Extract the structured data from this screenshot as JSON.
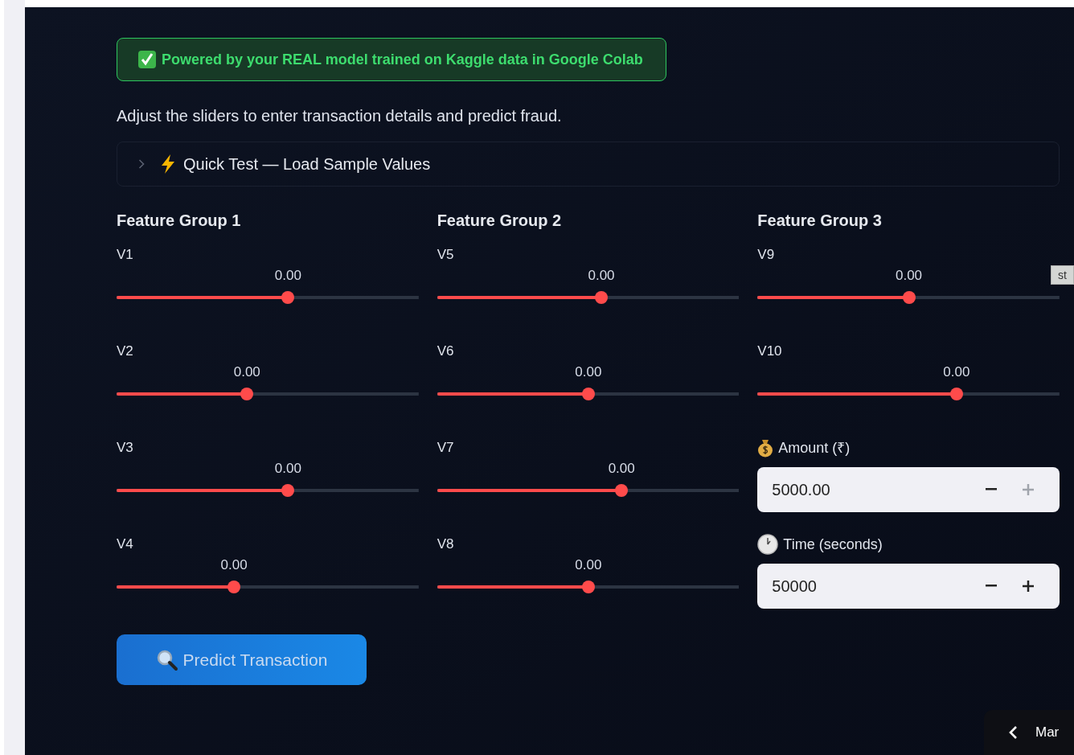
{
  "banner": {
    "text": "Powered by your REAL model trained on Kaggle data in Google Colab"
  },
  "intro": "Adjust the sliders to enter transaction details and predict fraud.",
  "expander": {
    "label": "Quick Test — Load Sample Values",
    "expanded": false
  },
  "groups": [
    {
      "title": "Feature Group 1",
      "items": [
        {
          "kind": "slider",
          "label": "V1",
          "reading": "0.00",
          "level": 0.568
        },
        {
          "kind": "slider",
          "label": "V2",
          "reading": "0.00",
          "level": 0.432
        },
        {
          "kind": "slider",
          "label": "V3",
          "reading": "0.00",
          "level": 0.568
        },
        {
          "kind": "slider",
          "label": "V4",
          "reading": "0.00",
          "level": 0.389
        }
      ]
    },
    {
      "title": "Feature Group 2",
      "items": [
        {
          "kind": "slider",
          "label": "V5",
          "reading": "0.00",
          "level": 0.544
        },
        {
          "kind": "slider",
          "label": "V6",
          "reading": "0.00",
          "level": 0.501
        },
        {
          "kind": "slider",
          "label": "V7",
          "reading": "0.00",
          "level": 0.611
        },
        {
          "kind": "slider",
          "label": "V8",
          "reading": "0.00",
          "level": 0.501
        }
      ]
    },
    {
      "title": "Feature Group 3",
      "items": [
        {
          "kind": "slider",
          "label": "V9",
          "reading": "0.00",
          "level": 0.501
        },
        {
          "kind": "slider",
          "label": "V10",
          "reading": "0.00",
          "level": 0.659
        },
        {
          "kind": "number",
          "label": "Amount (₹)",
          "value": "5000.00",
          "minus_disabled": false,
          "plus_disabled": true
        },
        {
          "kind": "number",
          "label": "Time (seconds)",
          "value": "50000",
          "minus_disabled": false,
          "plus_disabled": false
        }
      ]
    }
  ],
  "predict_button": "Predict Transaction",
  "tooltip": "st",
  "bottom_panel": {
    "label": "Mar"
  }
}
